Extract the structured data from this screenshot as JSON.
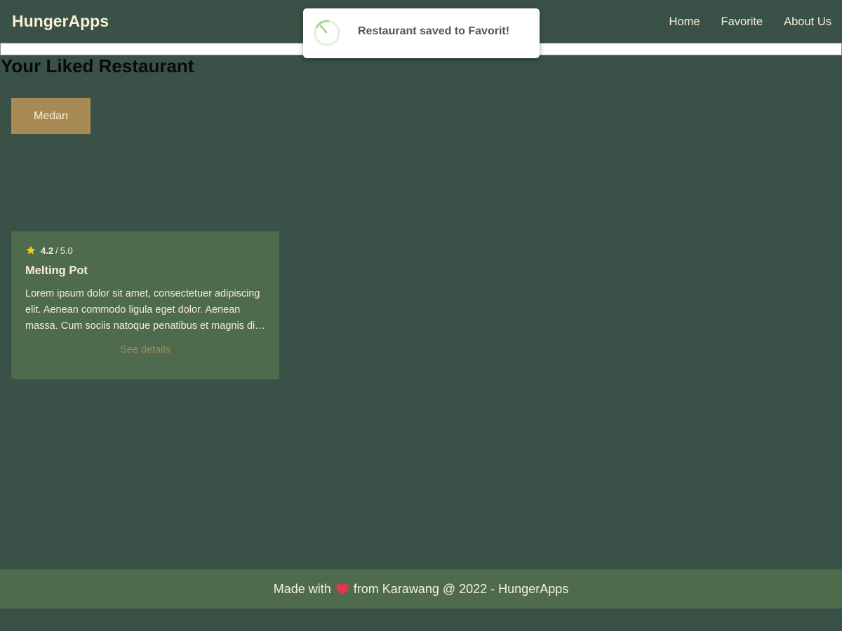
{
  "header": {
    "brand": "HungerApps",
    "nav": [
      "Home",
      "Favorite",
      "About Us"
    ]
  },
  "main": {
    "title": "Your Liked Restaurant",
    "city_button": "Medan",
    "card": {
      "rating_value": "4.2",
      "rating_separator": "/",
      "rating_max": "5.0",
      "name": "Melting Pot",
      "description": "Lorem ipsum dolor sit amet, consectetuer adipiscing elit. Aenean commodo ligula eget dolor. Aenean massa. Cum sociis natoque penatibus et magnis dis parturient montes, nascetur ridiculus mus.",
      "link": "See details"
    }
  },
  "toast": {
    "message": "Restaurant saved to Favorit!",
    "icon": "success-spinner-icon"
  },
  "footer": {
    "prefix": "Made with",
    "icon": "heart-icon",
    "suffix": "from Karawang @ 2022 - HungerApps"
  },
  "colors": {
    "background": "#395146",
    "card": "#4e6b4e",
    "accent": "#a88a54",
    "text": "#f8f0d8",
    "star": "#f5c518",
    "heart": "#e8344a",
    "toast_icon": "#a5dc86"
  }
}
